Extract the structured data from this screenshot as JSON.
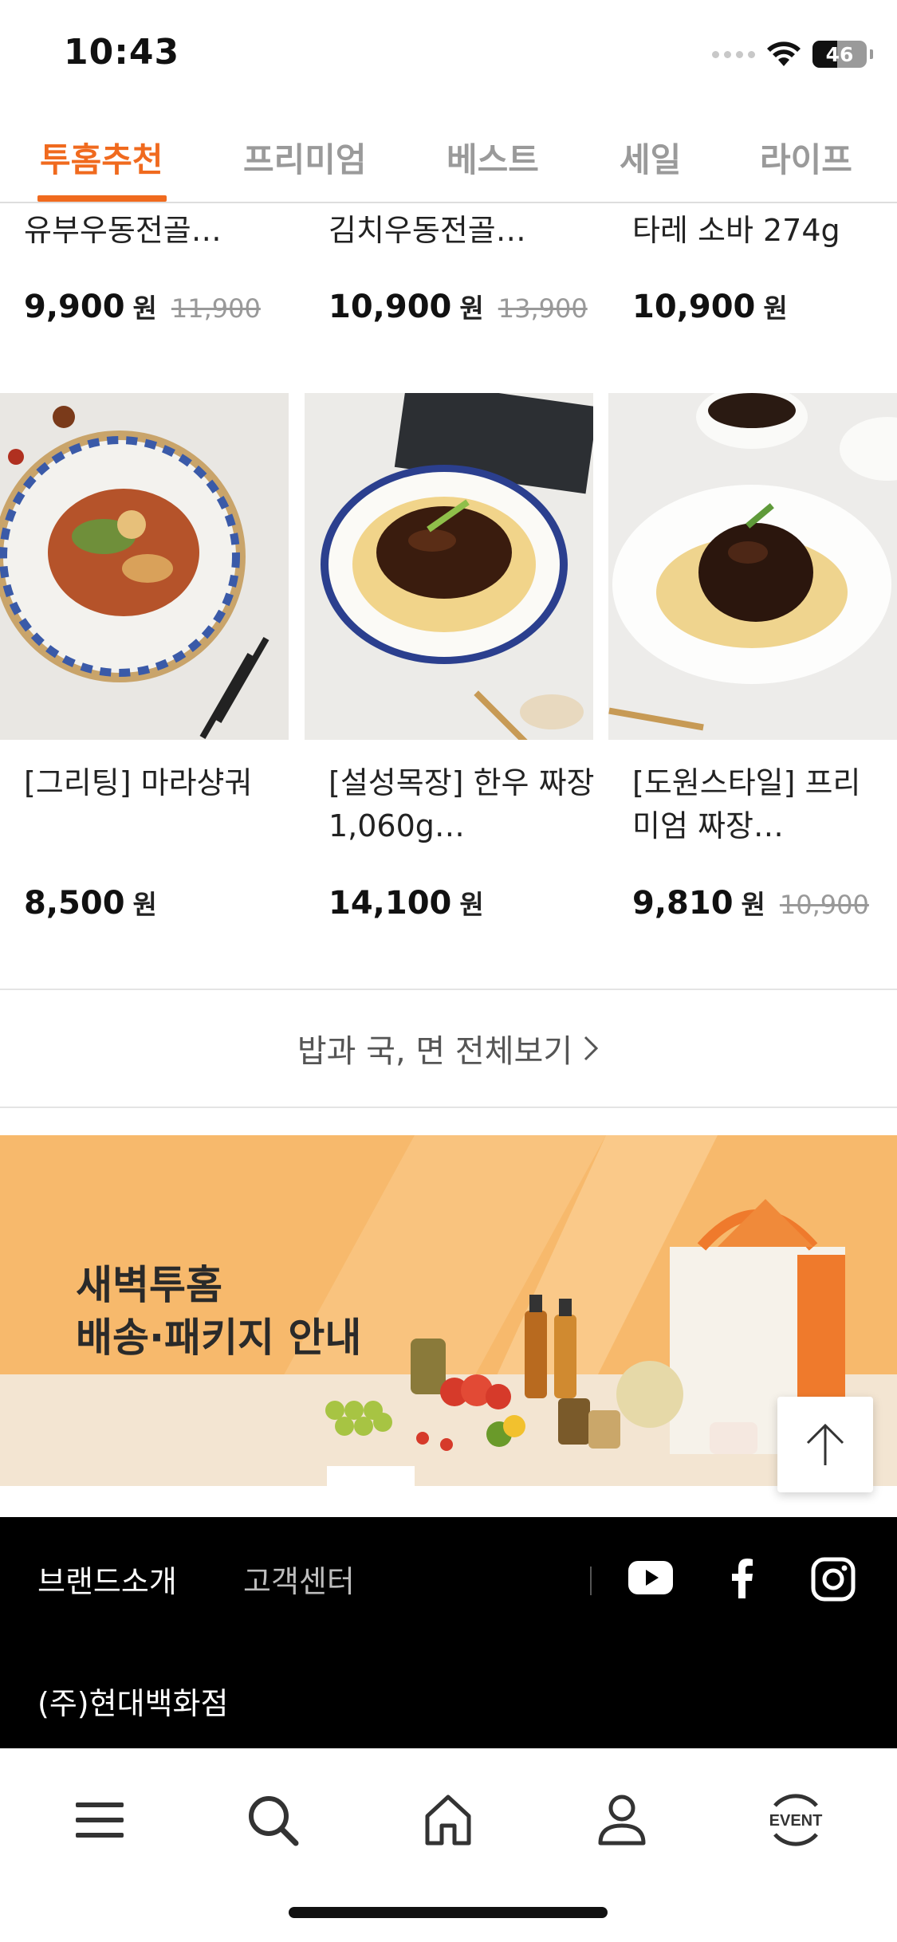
{
  "status_bar": {
    "time": "10:43",
    "battery": "46",
    "battery_level": 0.46
  },
  "tabs": [
    {
      "label": "투홈추천",
      "active": true
    },
    {
      "label": "프리미엄",
      "active": false
    },
    {
      "label": "베스트",
      "active": false
    },
    {
      "label": "세일",
      "active": false
    },
    {
      "label": "라이프",
      "active": false
    }
  ],
  "top_products": [
    {
      "name": "유부우동전골…",
      "price": "9,900",
      "currency": "원",
      "original_price": "11,900"
    },
    {
      "name": "김치우동전골…",
      "price": "10,900",
      "currency": "원",
      "original_price": "13,900"
    },
    {
      "name": "타레 소바 274g",
      "price": "10,900",
      "currency": "원",
      "original_price": ""
    }
  ],
  "products": [
    {
      "name": "[그리팅] 마라샹궈",
      "price": "8,500",
      "currency": "원",
      "original_price": ""
    },
    {
      "name": "[설성목장] 한우 짜장 1,060g…",
      "price": "14,100",
      "currency": "원",
      "original_price": ""
    },
    {
      "name": "[도원스타일] 프리미엄 짜장…",
      "price": "9,810",
      "currency": "원",
      "original_price": "10,900"
    }
  ],
  "view_all": {
    "label": "밥과 국, 면 전체보기"
  },
  "banner": {
    "line1": "새벽투홈",
    "line2": "배송·패키지 안내"
  },
  "footer": {
    "brand": "브랜드소개",
    "customer_center": "고객센터",
    "company": "(주)현대백화점"
  },
  "bottom_nav": {
    "items": [
      "menu-icon",
      "search-icon",
      "home-icon",
      "user-icon",
      "event-icon"
    ],
    "event_label": "EVENT"
  },
  "colors": {
    "accent": "#f06a1e",
    "banner_bg": "#f7b96c"
  }
}
